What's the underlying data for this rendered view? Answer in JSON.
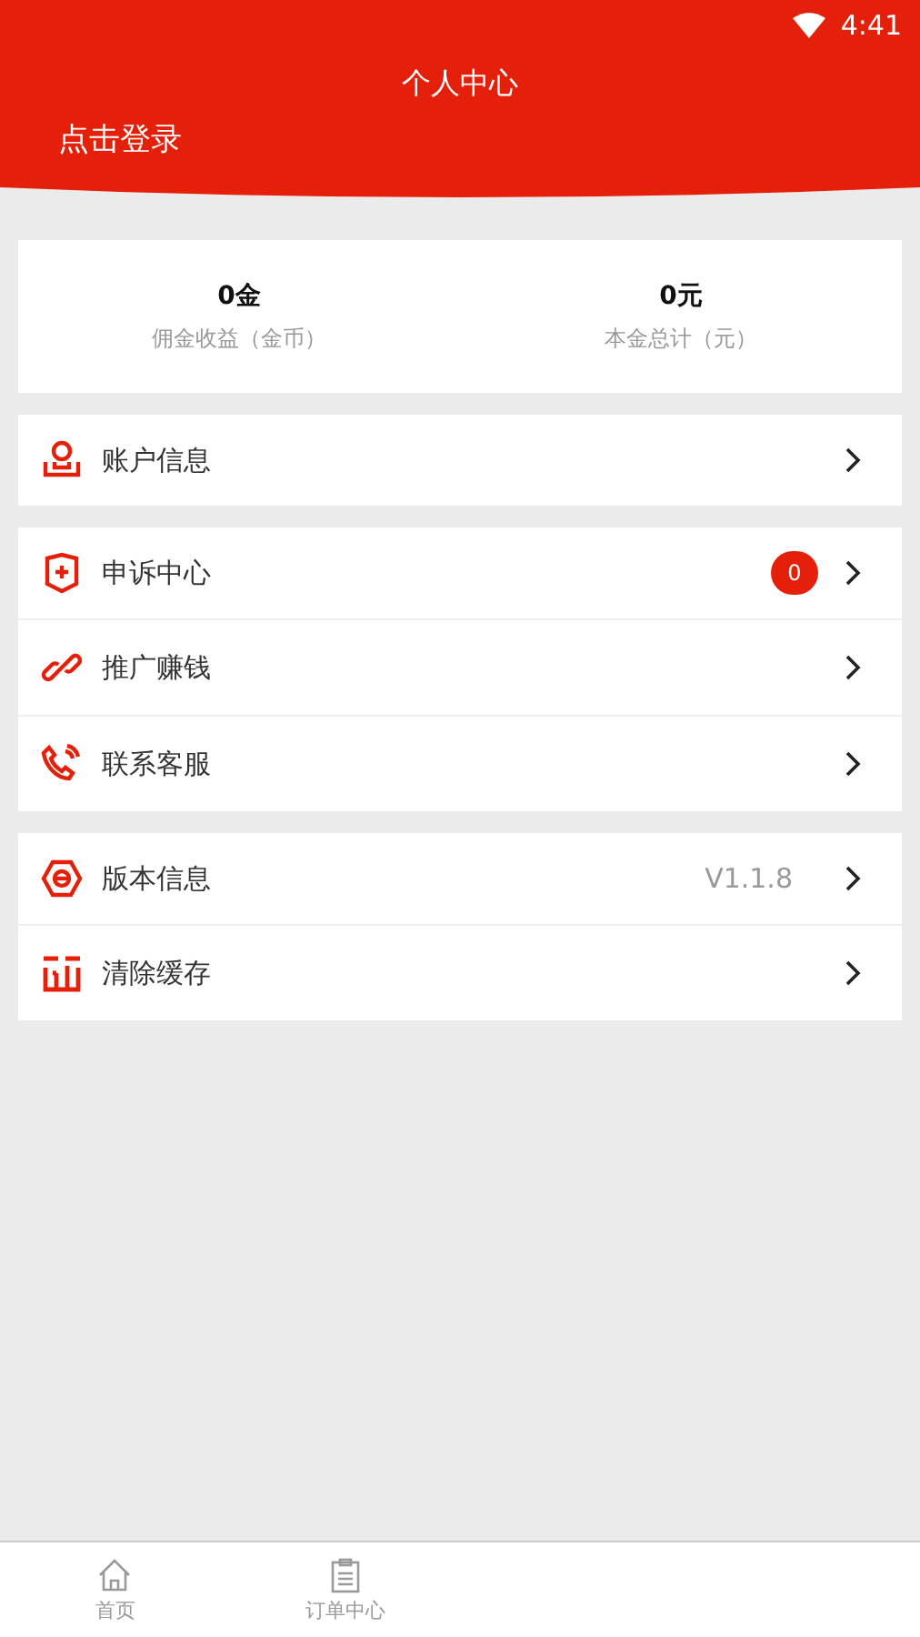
{
  "status_bar": {
    "time": "4:41"
  },
  "header": {
    "title": "个人中心",
    "login": "点击登录"
  },
  "stats": [
    {
      "value": "0金",
      "label": "佣金收益（金币）"
    },
    {
      "value": "0元",
      "label": "本金总计（元）"
    }
  ],
  "menu_groups": [
    [
      {
        "label": "账户信息"
      }
    ],
    [
      {
        "label": "申诉中心",
        "badge": "0"
      },
      {
        "label": "推广赚钱"
      },
      {
        "label": "联系客服"
      }
    ],
    [
      {
        "label": "版本信息",
        "value": "V1.1.8"
      },
      {
        "label": "清除缓存"
      }
    ]
  ],
  "bottom_nav": [
    {
      "label": "首页",
      "selected": false
    },
    {
      "label": "订单中心",
      "selected": false
    }
  ]
}
